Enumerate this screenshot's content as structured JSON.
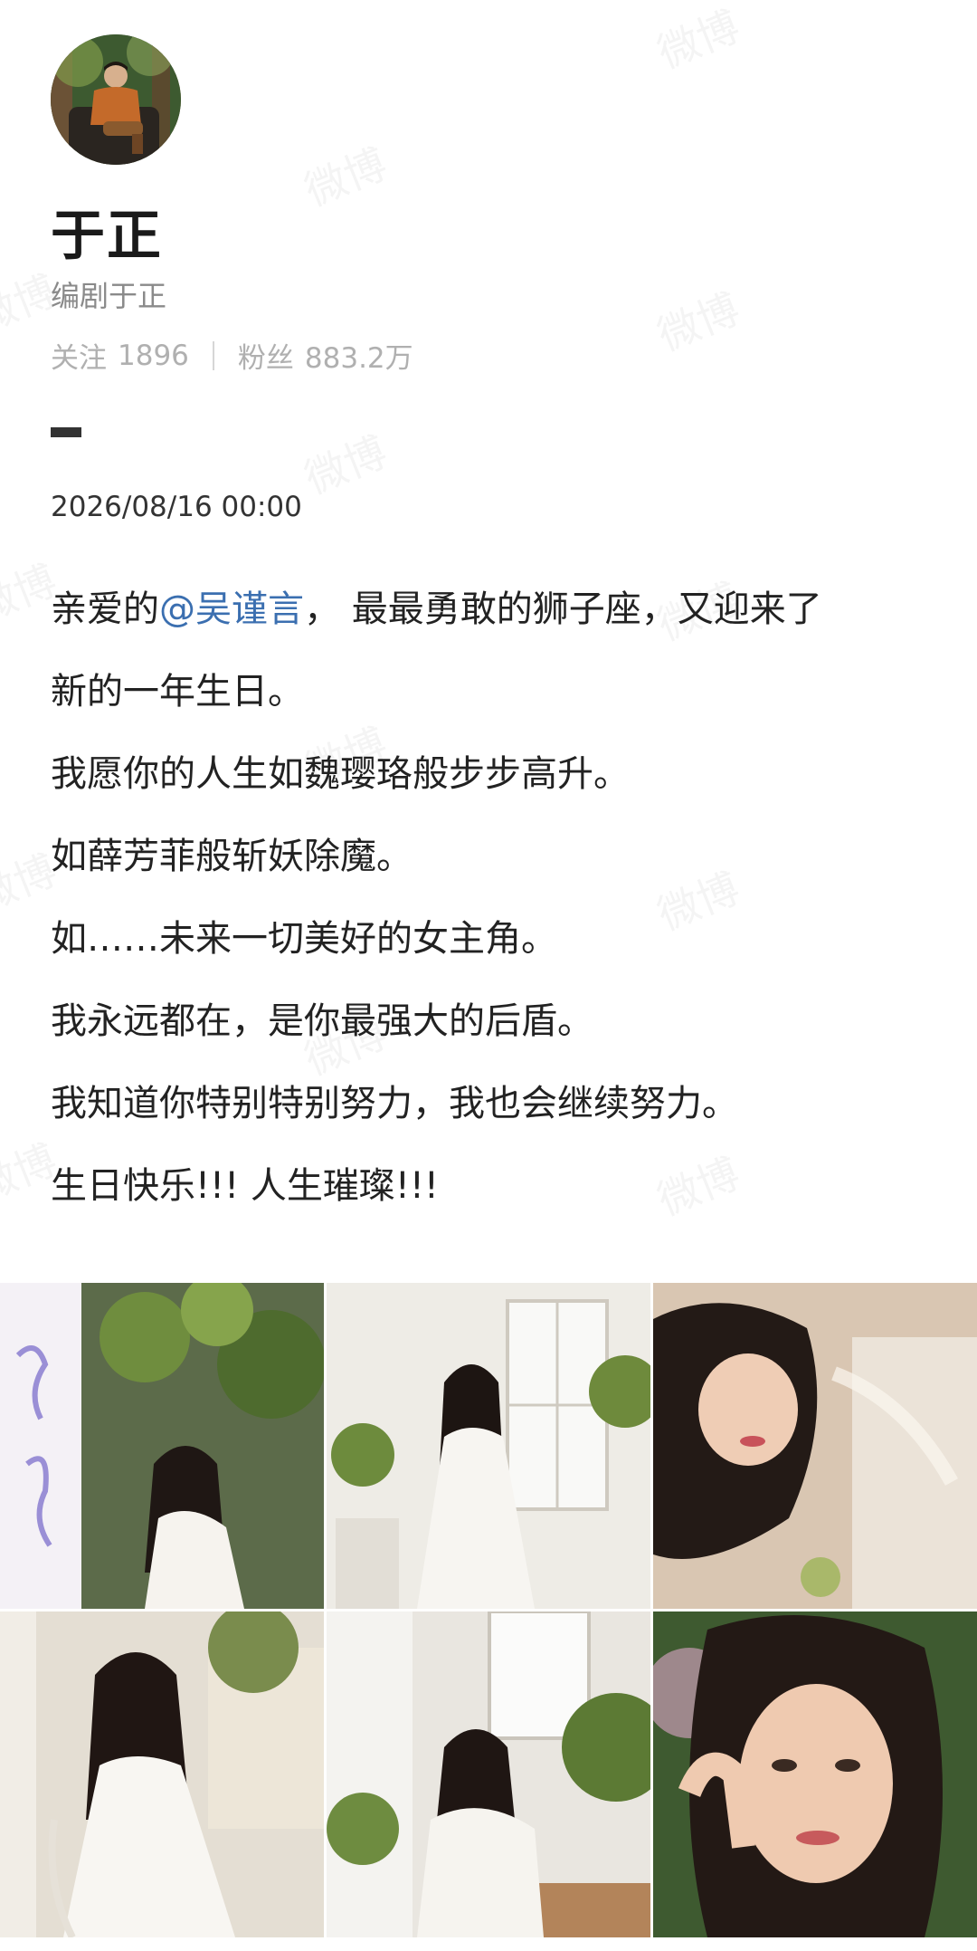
{
  "watermark_text": "微博",
  "profile": {
    "name": "于正",
    "description": "编剧于正",
    "following_label": "关注",
    "following_count": "1896",
    "followers_label": "粉丝",
    "followers_count": "883.2万"
  },
  "post": {
    "date": "2026/08/16 00:00",
    "line1_prefix": "亲爱的",
    "mention": "@吴谨言",
    "line1_suffix": "，  最最勇敢的狮子座，又迎来了",
    "line2": "新的一年生日。",
    "line3": "我愿你的人生如魏璎珞般步步高升。",
    "line4": "如薛芳菲般斩妖除魔。",
    "line5": "如……未来一切美好的女主角。",
    "line6": "我永远都在，是你最强大的后盾。",
    "line7": "我知道你特别特别努力，我也会继续努力。",
    "line8": "生日快乐!!!  人生璀璨!!!"
  },
  "gallery": {
    "photos": [
      {
        "name": "photo-1",
        "subject": "woman in white dress crouching by plants"
      },
      {
        "name": "photo-2",
        "subject": "woman in white dress sitting by window"
      },
      {
        "name": "photo-3",
        "subject": "woman lying on lace cloth"
      },
      {
        "name": "photo-4",
        "subject": "woman in white dress seated on chair"
      },
      {
        "name": "photo-5",
        "subject": "woman sitting on floor by door"
      },
      {
        "name": "photo-6",
        "subject": "close-up portrait of woman"
      }
    ]
  },
  "colors": {
    "mention": "#3b6fb0",
    "muted": "#8a8a8a",
    "stats": "#b0b0b0"
  }
}
